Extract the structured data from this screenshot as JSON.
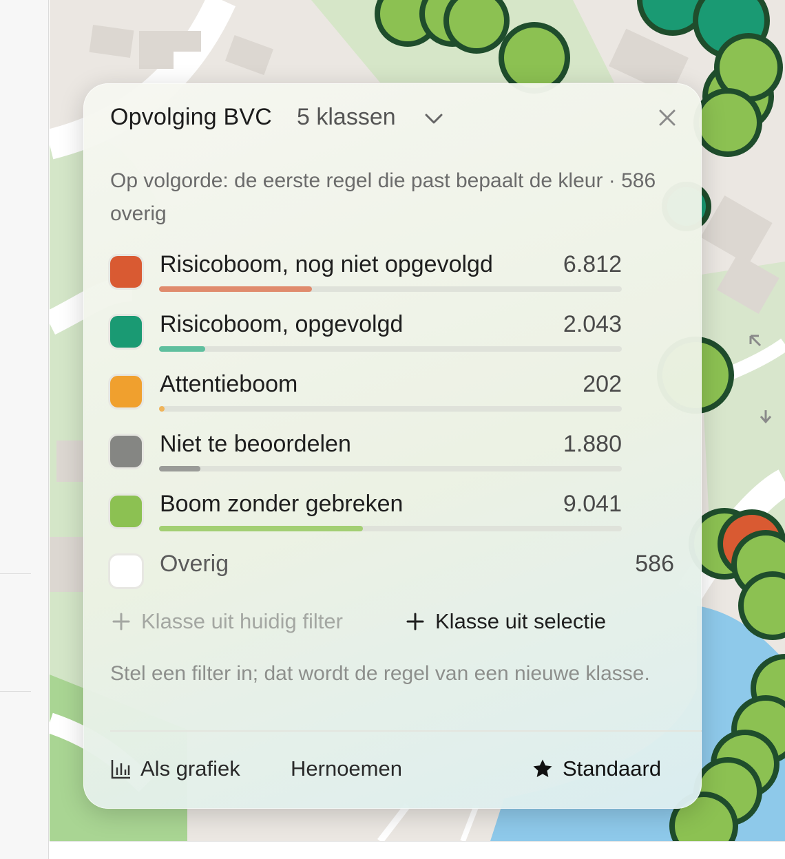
{
  "panel": {
    "title": "Opvolging BVC",
    "class_count_label": "5 klassen",
    "description": "Op volgorde: de eerste regel die past bepaalt de kleur · 586 overig",
    "classes": [
      {
        "label": "Risicoboom, nog niet opgevolgd",
        "count": "6.812",
        "fraction": 0.33,
        "color": "#d95a32",
        "bar_color": "#e08b6d"
      },
      {
        "label": "Risicoboom, opgevolgd",
        "count": "2.043",
        "fraction": 0.1,
        "color": "#1a9a73",
        "bar_color": "#5fbf9e"
      },
      {
        "label": "Attentieboom",
        "count": "202",
        "fraction": 0.012,
        "color": "#f0a02e",
        "bar_color": "#f0b45a"
      },
      {
        "label": "Niet te beoordelen",
        "count": "1.880",
        "fraction": 0.09,
        "color": "#858683",
        "bar_color": "#9a9b98"
      },
      {
        "label": "Boom zonder gebreken",
        "count": "9.041",
        "fraction": 0.44,
        "color": "#8cc152",
        "bar_color": "#a3cf73"
      }
    ],
    "other": {
      "label": "Overig",
      "count": "586",
      "color": "#ffffff"
    },
    "actions": {
      "add_from_filter": "Klasse uit huidig filter",
      "add_from_selection": "Klasse uit selectie"
    },
    "hint": "Stel een filter in; dat wordt de regel van een nieuwe klasse.",
    "footer": {
      "chart": "Als grafiek",
      "rename": "Hernoemen",
      "default": "Standaard"
    }
  },
  "icons": {
    "dropdown": "chevron-down-icon",
    "close": "close-icon",
    "add": "plus-icon",
    "chart": "bar-chart-icon",
    "star": "star-icon"
  }
}
